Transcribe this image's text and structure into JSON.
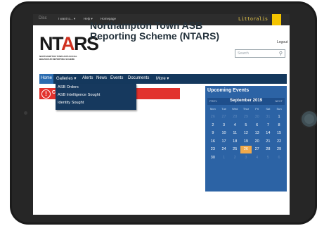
{
  "topbar": {
    "disc": "Disc",
    "items": [
      "I want to... ▾",
      "Help ▾",
      "Homepage"
    ],
    "brand": "Littoralis"
  },
  "logo": {
    "mark_left": "NT",
    "mark_red": "A",
    "mark_right": "RS",
    "sub1": "NORTHAMPTON TOWN ANTI-SOCIAL",
    "sub2": "BEHAVIOUR REPORTING SCHEME"
  },
  "header": {
    "title": "Northampton Town ASB Reporting Scheme (NTARS)",
    "logout": "Logout",
    "search_placeholder": "Search"
  },
  "nav": {
    "items": [
      "Home",
      "Galleries ▾",
      "Alerts",
      "News",
      "Events",
      "Documents",
      "More ▾"
    ]
  },
  "dropdown": {
    "items": [
      "ASB Orders",
      "ASB Intelligence Sought",
      "Identity Sought"
    ]
  },
  "alert": {
    "icon": "!",
    "letter": "C"
  },
  "events": {
    "title": "Upcoming Events",
    "prev": "PREV",
    "month": "September 2019",
    "next": "NEXT",
    "weekdays": [
      "Mon",
      "Tue",
      "Wed",
      "Thur",
      "Fri",
      "Sat",
      "Sun"
    ],
    "weeks": [
      [
        "26",
        "27",
        "28",
        "29",
        "30",
        "31",
        "1"
      ],
      [
        "2",
        "3",
        "4",
        "5",
        "6",
        "7",
        "8"
      ],
      [
        "9",
        "10",
        "11",
        "12",
        "13",
        "14",
        "15"
      ],
      [
        "16",
        "17",
        "18",
        "19",
        "20",
        "21",
        "22"
      ],
      [
        "23",
        "24",
        "25",
        "26",
        "27",
        "28",
        "29"
      ],
      [
        "30",
        "1",
        "2",
        "3",
        "4",
        "5",
        "6"
      ]
    ],
    "today": "26",
    "colors": {
      "panel": "#2c63a5",
      "today": "#f0a94b"
    }
  },
  "colors": {
    "nav": "#14385d",
    "nav_active": "#2b6cb0",
    "alert": "#e2322d",
    "brand": "#f4c400"
  }
}
